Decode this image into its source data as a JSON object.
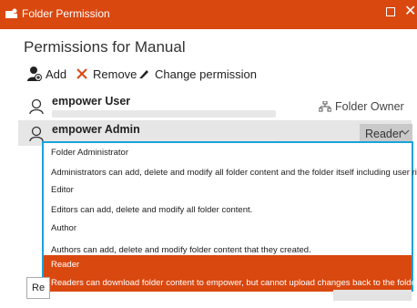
{
  "window": {
    "title": "Folder Permission",
    "icon": "folder-people-icon",
    "maximize_icon": "maximize-icon",
    "close_icon": "close-icon",
    "close_glyph": "✕"
  },
  "heading": "Permissions for Manual",
  "toolbar": {
    "add_label": "Add",
    "remove_label": "Remove",
    "change_label": "Change permission"
  },
  "users": [
    {
      "name": "empower User",
      "role": "Folder Owner"
    },
    {
      "name": "empower Admin",
      "role": "Reader"
    }
  ],
  "dropdown": {
    "options": [
      {
        "title": "Folder Administrator",
        "description": "Administrators can add, delete and modify all folder content and the folder itself including user rights."
      },
      {
        "title": "Editor",
        "description": "Editors can add, delete and modify all folder content."
      },
      {
        "title": "Author",
        "description": "Authors can add, delete and modify folder content that they created."
      },
      {
        "title": "Reader",
        "description": "Readers can download folder content to empower, but cannot upload changes back to the folder."
      }
    ],
    "selected": "Reader"
  },
  "footer": {
    "partial_button_label": "Re"
  },
  "colors": {
    "accent": "#d9480f",
    "focus_border": "#1aa3d9",
    "selected_row": "#e6e6e6",
    "select_bg": "#c9c9c9"
  }
}
